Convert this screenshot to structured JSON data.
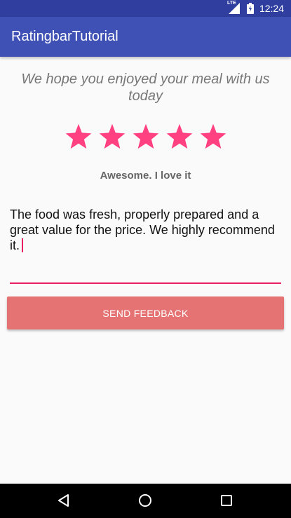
{
  "status_bar": {
    "time": "12:24",
    "network": "LTE",
    "icons": [
      "signal-icon",
      "battery-icon"
    ]
  },
  "app_bar": {
    "title": "RatingbarTutorial"
  },
  "main": {
    "prompt": "We hope you enjoyed your meal with us today",
    "rating": {
      "value": 5,
      "max": 5,
      "color": "#ff4081"
    },
    "rating_text": "Awesome. I love it",
    "feedback": {
      "value": "The food was fresh, properly prepared and a great value for the price. We highly recommend it.",
      "underline_color": "#e91e63"
    },
    "send_button": {
      "label": "SEND FEEDBACK",
      "color": "#e57373"
    }
  },
  "nav_bar": {
    "icons": [
      "back-icon",
      "home-icon",
      "recents-icon"
    ]
  },
  "colors": {
    "primary": "#3f51b5",
    "primary_dark": "#303f9f",
    "accent": "#ff4081"
  }
}
